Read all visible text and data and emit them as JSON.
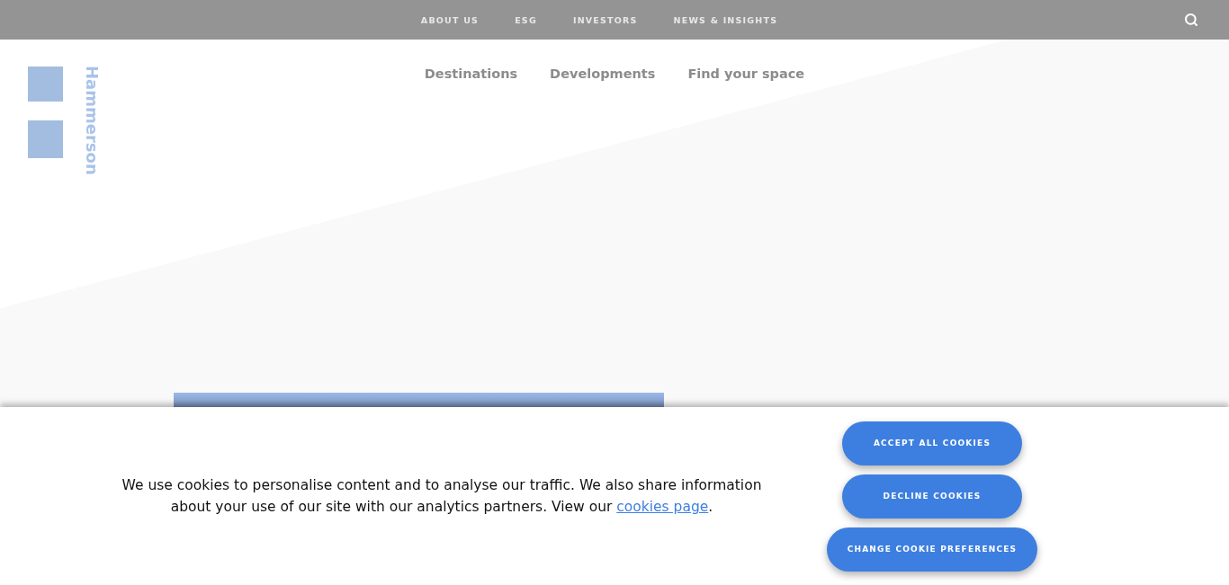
{
  "top_nav": {
    "links": [
      "ABOUT US",
      "ESG",
      "INVESTORS",
      "NEWS & INSIGHTS"
    ]
  },
  "logo": {
    "wordmark": "Hammerson"
  },
  "main_nav": {
    "links": [
      "Destinations",
      "Developments",
      "Find your space"
    ]
  },
  "cookie_banner": {
    "message": "We use cookies to personalise content and to analyse our traffic. We also share information about your use of our site with our analytics partners. View our ",
    "link": "cookies page",
    "trailing": ".",
    "buttons": [
      "ACCEPT ALL COOKIES",
      "DECLINE COOKIES",
      "CHANGE COOKIE PREFERENCES"
    ]
  }
}
